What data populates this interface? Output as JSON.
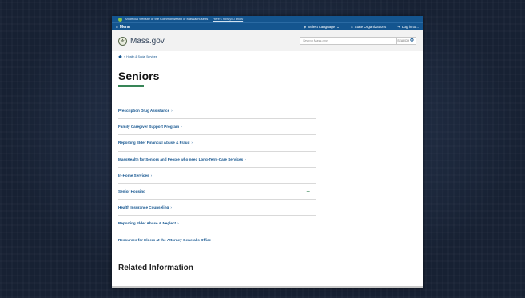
{
  "official_bar": {
    "text": "An official website of the Commonwealth of Massachusetts",
    "link": "Here's how you know"
  },
  "nav": {
    "menu_label": "Menu",
    "language_label": "Select Language",
    "state_orgs_label": "State Organizations",
    "login_label": "Log in to..."
  },
  "header": {
    "logo_text": "Mass.gov",
    "search_placeholder": "Search Mass.gov",
    "search_button": "SEARCH"
  },
  "breadcrumb": {
    "item": "Health & Social Services"
  },
  "page": {
    "title": "Seniors",
    "related_heading": "Related Information"
  },
  "links": [
    {
      "label": "Prescription Drug Assistance"
    },
    {
      "label": "Family Caregiver Support Program"
    },
    {
      "label": "Reporting Elder Financial Abuse & Fraud"
    },
    {
      "label": "MassHealth for Seniors and People who need Long-Term-Care Services"
    },
    {
      "label": "In-Home Services"
    },
    {
      "label": "Senior Housing"
    },
    {
      "label": "Health Insurance Counseling"
    },
    {
      "label": "Reporting Elder Abuse & Neglect"
    },
    {
      "label": "Resources for Elders at the Attorney General's Office"
    }
  ],
  "colors": {
    "brand_blue": "#14558f",
    "accent_green": "#388557",
    "background": "#172133"
  }
}
